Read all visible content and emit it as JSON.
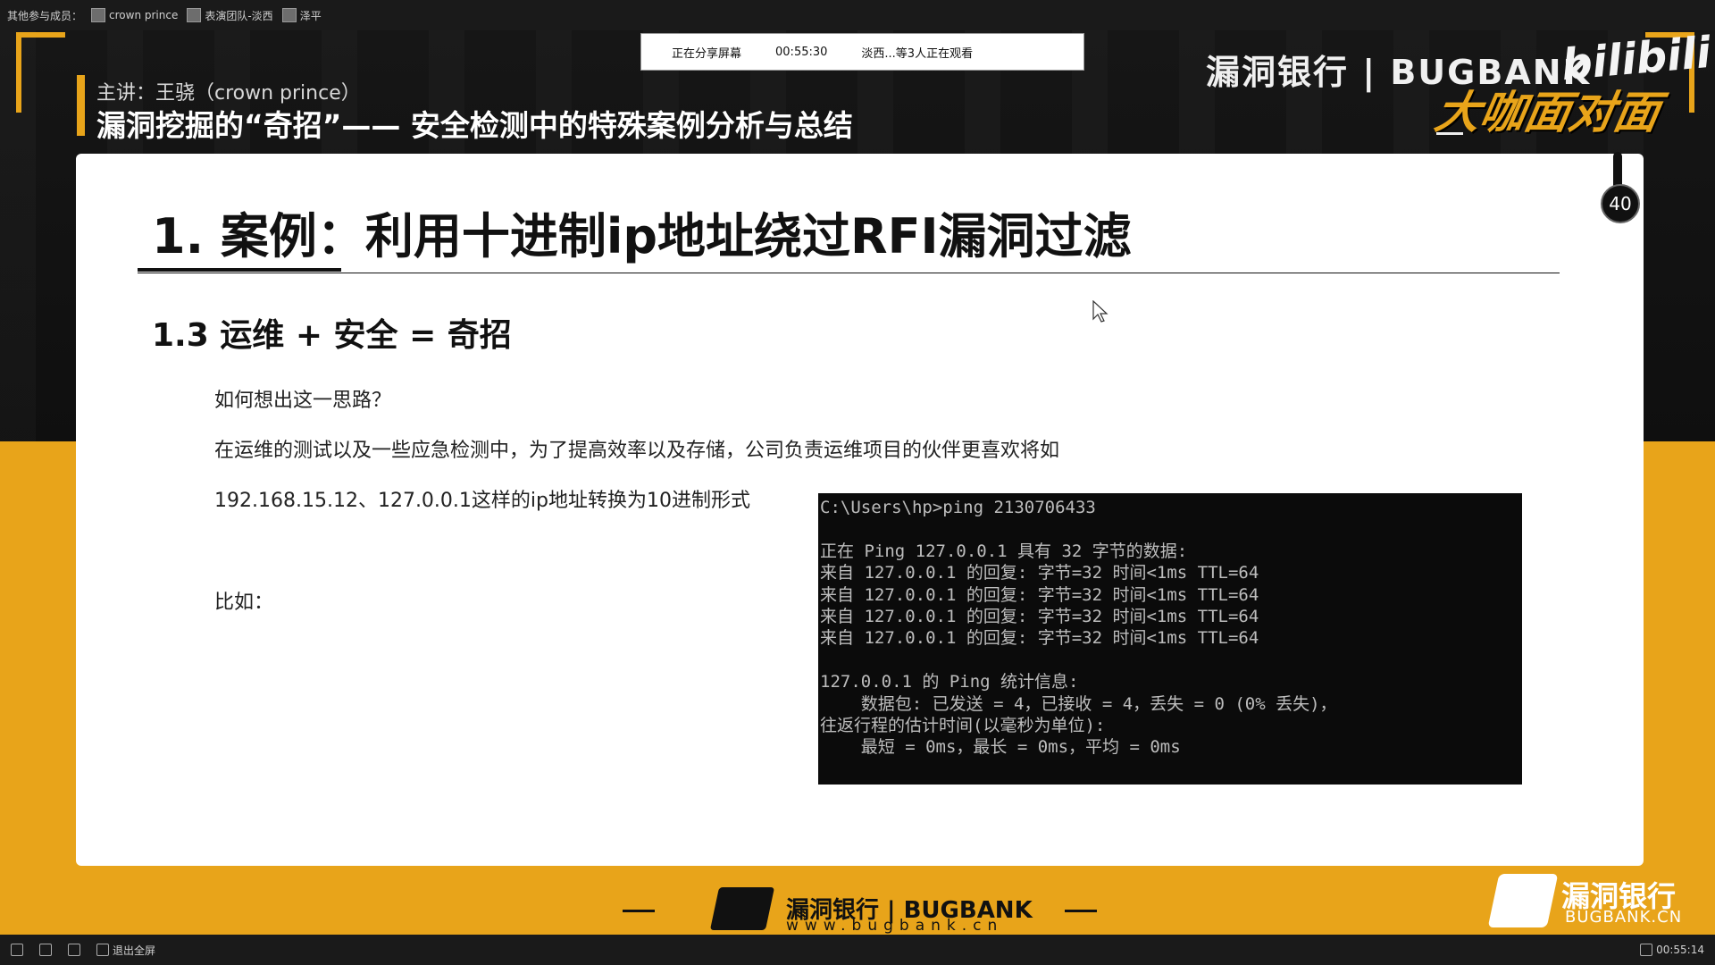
{
  "topbar": {
    "label": "其他参与成员：",
    "participants": [
      {
        "name": "crown prince"
      },
      {
        "name": "表演团队-淡西"
      },
      {
        "name": "泽平"
      }
    ]
  },
  "share": {
    "status": "正在分享屏幕",
    "elapsed": "00:55:30",
    "viewers": "淡西...等3人正在观看"
  },
  "header": {
    "speaker": "主讲：王骁（crown prince）",
    "talk_title": "漏洞挖掘的“奇招”—— 安全检测中的特殊案例分析与总结",
    "brand": "漏洞银行 | BUGBANK",
    "platform_logo": "bilibili",
    "show_name": "大咖面对面"
  },
  "slide": {
    "title": "1. 案例：利用十进制ip地址绕过RFI漏洞过滤",
    "section": "1.3 运维 + 安全 = 奇招",
    "question": "如何想出这一思路？",
    "paragraph1": "在运维的测试以及一些应急检测中，为了提高效率以及存储，公司负责运维项目的伙伴更喜欢将如",
    "paragraph2": "192.168.15.12、127.0.0.1这样的ip地址转换为10进制形式",
    "example_label": "比如：",
    "page_number": "40"
  },
  "terminal": {
    "lines": [
      "C:\\Users\\hp>ping 2130706433",
      "",
      "正在 Ping 127.0.0.1 具有 32 字节的数据:",
      "来自 127.0.0.1 的回复: 字节=32 时间<1ms TTL=64",
      "来自 127.0.0.1 的回复: 字节=32 时间<1ms TTL=64",
      "来自 127.0.0.1 的回复: 字节=32 时间<1ms TTL=64",
      "来自 127.0.0.1 的回复: 字节=32 时间<1ms TTL=64",
      "",
      "127.0.0.1 的 Ping 统计信息:",
      "    数据包: 已发送 = 4，已接收 = 4，丢失 = 0 (0% 丢失)，",
      "往返行程的估计时间(以毫秒为单位):",
      "    最短 = 0ms，最长 = 0ms，平均 = 0ms"
    ]
  },
  "footer": {
    "brand_name": "漏洞银行 | BUGBANK",
    "brand_url": "www.bugbank.cn",
    "corner_name": "漏洞银行",
    "corner_url": "BUGBANK.CN"
  },
  "controls": {
    "exit_fullscreen": "退出全屏",
    "clock": "00:55:14"
  },
  "colors": {
    "accent": "#e8a41a",
    "terminal_bg": "#0b0b0b",
    "terminal_text": "#bdbdbd"
  },
  "icons": [
    "mic-icon",
    "speaker-icon",
    "camera-icon",
    "fullscreen-exit-icon",
    "signal-icon",
    "cursor-icon"
  ]
}
